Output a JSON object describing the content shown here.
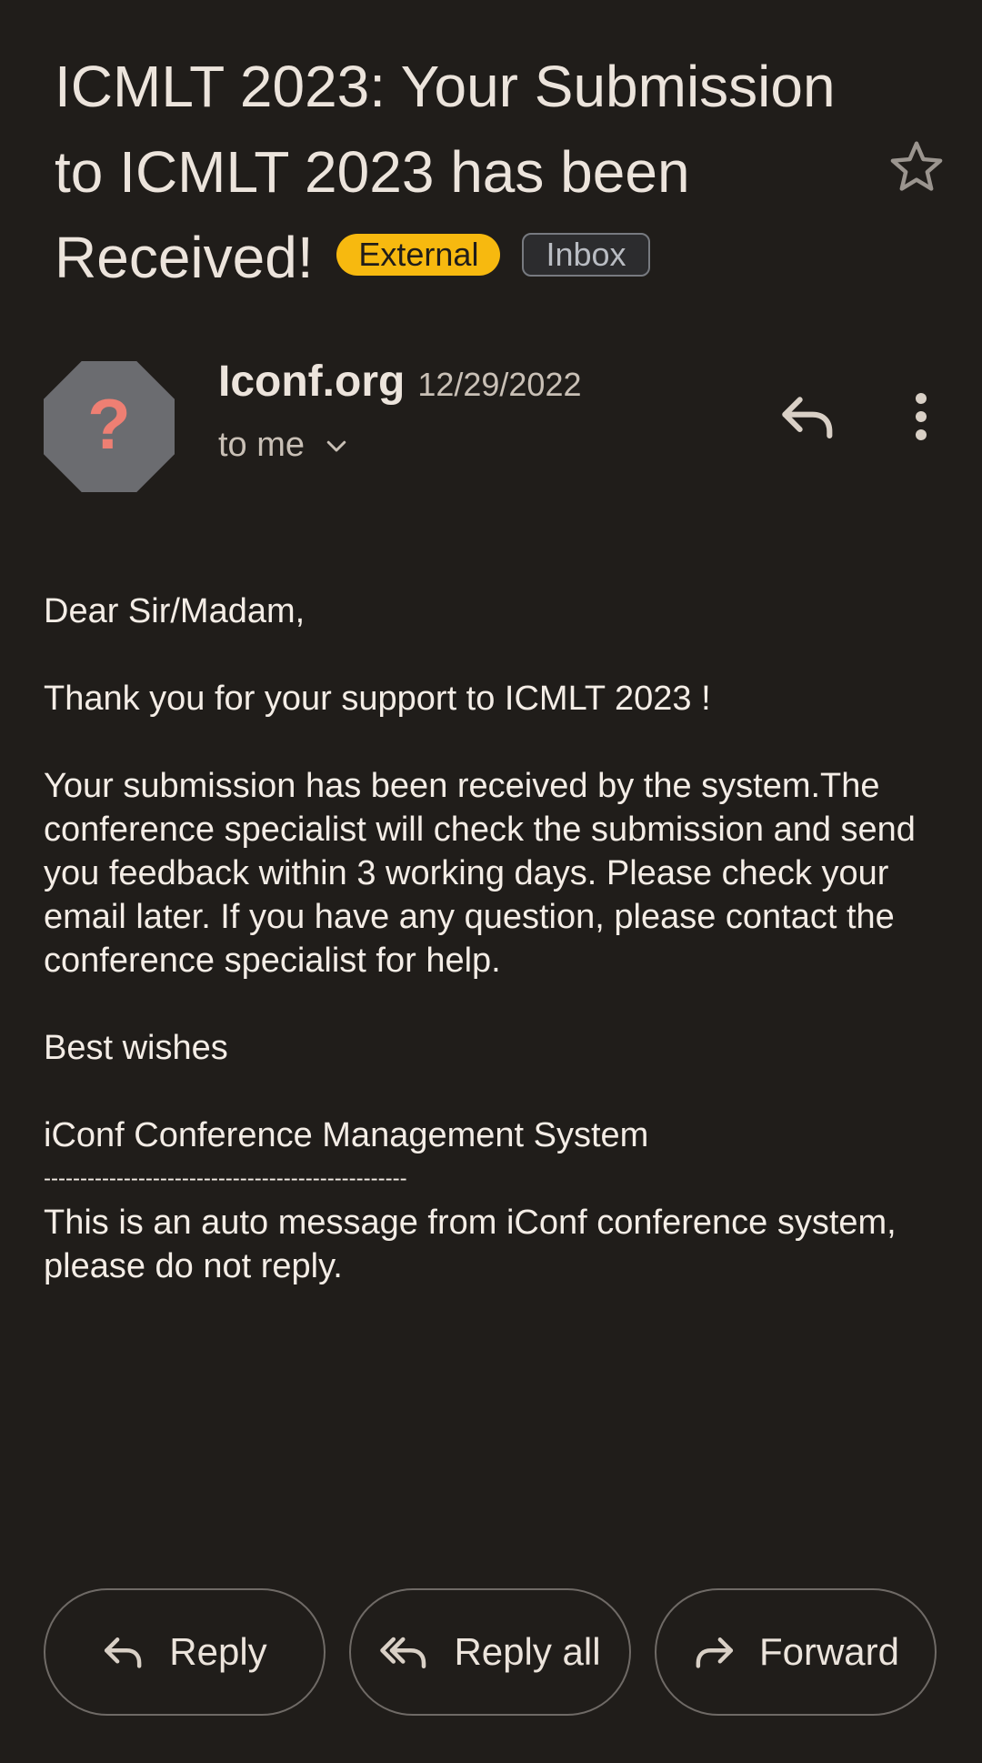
{
  "subject": {
    "title": "ICMLT 2023: Your Submission to ICMLT 2023 has been Received!",
    "labels": [
      "External",
      "Inbox"
    ]
  },
  "message": {
    "avatar_glyph": "?",
    "sender": "Iconf.org",
    "date": "12/29/2022",
    "recipient": "to me",
    "body": [
      "Dear Sir/Madam,",
      "Thank you for your support to ICMLT 2023 !",
      "Your submission has been received by the system.The conference specialist will check the submission and send you feedback within 3 working days. Please check your email later. If you have any question, please contact the conference specialist for help.",
      "Best wishes",
      "iConf Conference Management System",
      "--------------------------------------------------",
      "This is an auto message from iConf conference system, please do not reply."
    ]
  },
  "actions": {
    "reply": "Reply",
    "reply_all": "Reply all",
    "forward": "Forward"
  },
  "colors": {
    "background": "#201d1a",
    "external_chip": "#f7b90f",
    "avatar": "#6b6c70",
    "avatar_glyph": "#ee7f73"
  },
  "icons": {
    "star": "star-icon",
    "reply": "reply-icon",
    "more": "more-vert-icon",
    "expand": "chevron-down-icon",
    "reply_all": "reply-all-icon",
    "forward": "forward-icon"
  }
}
